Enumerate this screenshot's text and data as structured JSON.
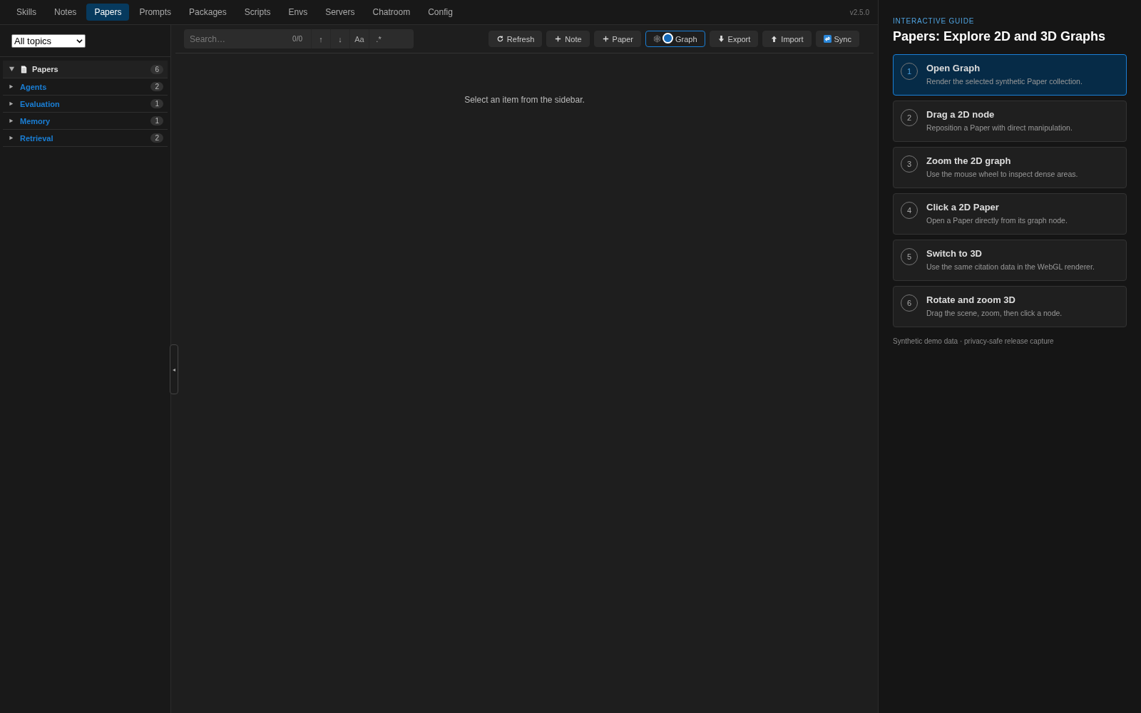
{
  "nav": {
    "tabs": [
      {
        "label": "Skills",
        "selected": false
      },
      {
        "label": "Notes",
        "selected": false
      },
      {
        "label": "Papers",
        "selected": true
      },
      {
        "label": "Prompts",
        "selected": false
      },
      {
        "label": "Packages",
        "selected": false
      },
      {
        "label": "Scripts",
        "selected": false
      },
      {
        "label": "Envs",
        "selected": false
      },
      {
        "label": "Servers",
        "selected": false
      },
      {
        "label": "Chatroom",
        "selected": false
      },
      {
        "label": "Config",
        "selected": false
      }
    ],
    "version": "v2.5.0"
  },
  "sidebar": {
    "filter": {
      "value": "All topics"
    },
    "tree": [
      {
        "label": "Papers",
        "count": "6",
        "expanded": true,
        "children": [
          {
            "label": "Agents",
            "count": "2",
            "expanded": false
          },
          {
            "label": "Evaluation",
            "count": "1",
            "expanded": false
          },
          {
            "label": "Memory",
            "count": "1",
            "expanded": false
          },
          {
            "label": "Retrieval",
            "count": "2",
            "expanded": false
          }
        ]
      }
    ],
    "collapse_toggle": "◂"
  },
  "search": {
    "placeholder": "Search…",
    "match_count": "0/0",
    "options": [
      "↑",
      "↓",
      "Aa",
      ".*"
    ]
  },
  "toolbar": [
    {
      "kind": "refresh",
      "label": "Refresh",
      "selected": false
    },
    {
      "kind": "plus",
      "label": "Note",
      "selected": false
    },
    {
      "kind": "plus",
      "label": "Paper",
      "selected": false
    },
    {
      "kind": "graph",
      "label": "Graph",
      "selected": true
    },
    {
      "kind": "export",
      "label": "Export",
      "selected": false
    },
    {
      "kind": "import",
      "label": "Import",
      "selected": false
    },
    {
      "kind": "sync",
      "label": "Sync",
      "selected": false
    }
  ],
  "content": {
    "empty_message": "Select an item from the sidebar."
  },
  "guide": {
    "eyebrow": "INTERACTIVE GUIDE",
    "title": "Papers: Explore 2D and 3D Graphs",
    "steps": [
      {
        "number": "1",
        "title": "Open Graph",
        "description": "Render the selected synthetic Paper collection.",
        "selected": true
      },
      {
        "number": "2",
        "title": "Drag a 2D node",
        "description": "Reposition a Paper with direct manipulation.",
        "selected": false
      },
      {
        "number": "3",
        "title": "Zoom the 2D graph",
        "description": "Use the mouse wheel to inspect dense areas.",
        "selected": false
      },
      {
        "number": "4",
        "title": "Click a 2D Paper",
        "description": "Open a Paper directly from its graph node.",
        "selected": false
      },
      {
        "number": "5",
        "title": "Switch to 3D",
        "description": "Use the same citation data in the WebGL renderer.",
        "selected": false
      },
      {
        "number": "6",
        "title": "Rotate and zoom 3D",
        "description": "Drag the scene, zoom, then click a node.",
        "selected": false
      }
    ],
    "footer": "Synthetic demo data · privacy-safe release capture"
  }
}
